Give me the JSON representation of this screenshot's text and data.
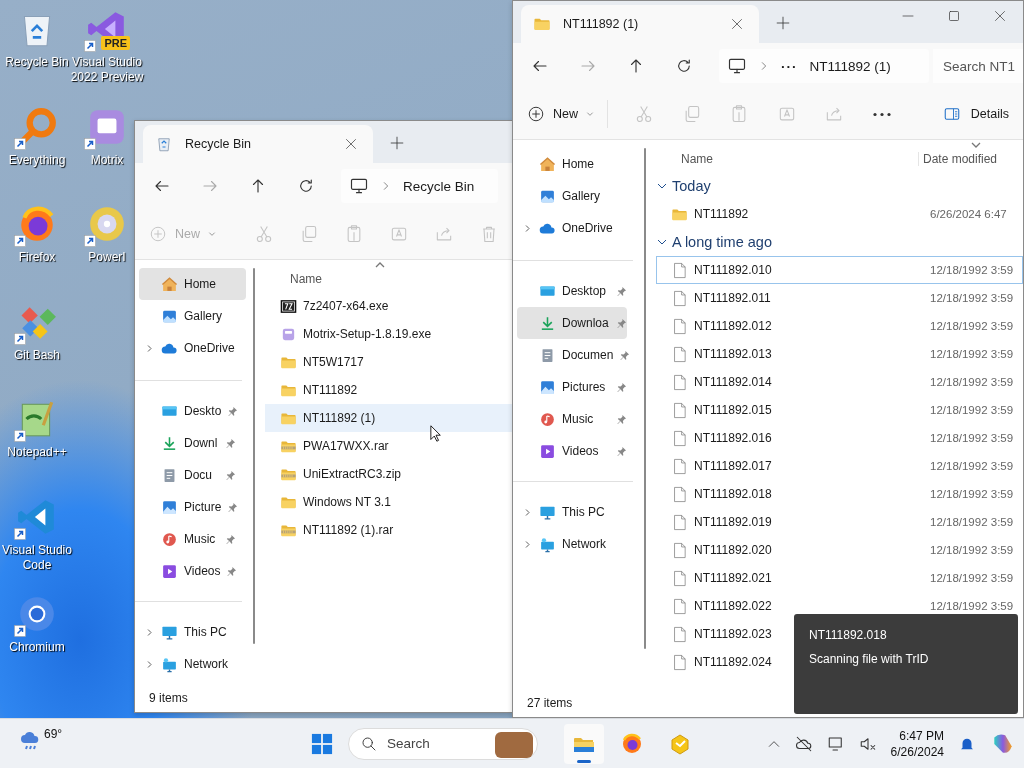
{
  "desktop_icons": [
    {
      "label": "Recycle Bin",
      "kind": "recycle",
      "shortcut": false
    },
    {
      "label": "Everything",
      "kind": "everything",
      "shortcut": true
    },
    {
      "label": "Firefox",
      "kind": "firefox",
      "shortcut": true
    },
    {
      "label": "Git Bash",
      "kind": "gitbash",
      "shortcut": true
    },
    {
      "label": "Notepad++",
      "kind": "notepad",
      "shortcut": true
    },
    {
      "label": "Visual Studio Code",
      "kind": "vscode",
      "shortcut": true
    },
    {
      "label": "Chromium",
      "kind": "chromium",
      "shortcut": true
    },
    {
      "label": "Visual Studio 2022 Preview",
      "kind": "vs",
      "shortcut": true,
      "badge": "PRE"
    },
    {
      "label": "Motrix",
      "kind": "motrix",
      "shortcut": true
    },
    {
      "label": "PowerI",
      "kind": "poweriso",
      "shortcut": true
    }
  ],
  "windows": [
    {
      "tab": {
        "title": "Recycle Bin"
      },
      "breadcrumb": [
        {
          "label": "Recycle Bin",
          "kind": "folder"
        }
      ],
      "toolbar": {
        "new": {
          "label": "New",
          "disabled": true
        },
        "actions": [
          {
            "kind": "cut",
            "disabled": true
          },
          {
            "kind": "copy",
            "disabled": true
          },
          {
            "kind": "paste",
            "disabled": true
          },
          {
            "kind": "rename",
            "disabled": true
          },
          {
            "kind": "share",
            "disabled": true
          },
          {
            "kind": "delete",
            "disabled": true
          }
        ]
      },
      "nav": [
        [
          {
            "label": "Home",
            "kind": "home",
            "selected": true,
            "pinned": false,
            "expandable": false
          },
          {
            "label": "Gallery",
            "kind": "gallery",
            "selected": false,
            "pinned": false,
            "expandable": false
          },
          {
            "label": "OneDrive",
            "kind": "onedrive",
            "selected": false,
            "pinned": false,
            "expandable": true
          }
        ],
        [
          {
            "label": "Deskto",
            "kind": "desktop",
            "selected": false,
            "pinned": true,
            "expandable": false
          },
          {
            "label": "Downl",
            "kind": "downloads",
            "selected": false,
            "pinned": true,
            "expandable": false
          },
          {
            "label": "Docu",
            "kind": "documents",
            "selected": false,
            "pinned": true,
            "expandable": false
          },
          {
            "label": "Picture",
            "kind": "pictures",
            "selected": false,
            "pinned": true,
            "expandable": false
          },
          {
            "label": "Music",
            "kind": "music",
            "selected": false,
            "pinned": true,
            "expandable": false
          },
          {
            "label": "Videos",
            "kind": "videos",
            "selected": false,
            "pinned": true,
            "expandable": false
          }
        ],
        [
          {
            "label": "This PC",
            "kind": "thispc",
            "selected": false,
            "pinned": false,
            "expandable": true
          },
          {
            "label": "Network",
            "kind": "network",
            "selected": false,
            "pinned": false,
            "expandable": true
          }
        ]
      ],
      "columns": [
        {
          "label": "Name",
          "sorted": true,
          "ascending": true
        }
      ],
      "groups": [
        {
          "files": [
            {
              "name": "7z2407-x64.exe",
              "kind": "sevenzip",
              "hovered": false
            },
            {
              "name": "Motrix-Setup-1.8.19.exe",
              "kind": "installer",
              "hovered": false
            },
            {
              "name": "NT5W1717",
              "kind": "folder",
              "hovered": false
            },
            {
              "name": "NT111892",
              "kind": "folder",
              "hovered": false
            },
            {
              "name": "NT111892 (1)",
              "kind": "folder",
              "hovered": true
            },
            {
              "name": "PWA17WXX.rar",
              "kind": "archive",
              "hovered": false
            },
            {
              "name": "UniExtractRC3.zip",
              "kind": "archive",
              "hovered": false
            },
            {
              "name": "Windows NT 3.1",
              "kind": "folder",
              "hovered": false
            },
            {
              "name": "NT111892 (1).rar",
              "kind": "archive",
              "hovered": false
            }
          ]
        }
      ],
      "status": "9 items"
    },
    {
      "tab": {
        "title": "NT111892 (1)"
      },
      "window_controls": true,
      "breadcrumb": [
        {
          "label": "···",
          "kind": "overflow"
        },
        {
          "label": "NT111892 (1)",
          "kind": "folder"
        }
      ],
      "search": {
        "placeholder": "Search NT1"
      },
      "toolbar": {
        "new": {
          "label": "New",
          "disabled": false
        },
        "actions": [
          {
            "kind": "cut",
            "disabled": true
          },
          {
            "kind": "copy",
            "disabled": true
          },
          {
            "kind": "paste",
            "disabled": true
          },
          {
            "kind": "rename",
            "disabled": true
          },
          {
            "kind": "share",
            "disabled": true
          },
          {
            "kind": "more",
            "disabled": false
          }
        ],
        "details": {
          "label": "Details"
        }
      },
      "nav": [
        [
          {
            "label": "Home",
            "kind": "home",
            "selected": false,
            "pinned": false,
            "expandable": false
          },
          {
            "label": "Gallery",
            "kind": "gallery",
            "selected": false,
            "pinned": false,
            "expandable": false
          },
          {
            "label": "OneDrive",
            "kind": "onedrive",
            "selected": false,
            "pinned": false,
            "expandable": true
          }
        ],
        [
          {
            "label": "Desktop",
            "kind": "desktop",
            "selected": false,
            "pinned": true,
            "expandable": false
          },
          {
            "label": "Downloa",
            "kind": "downloads",
            "selected": true,
            "pinned": true,
            "expandable": false
          },
          {
            "label": "Documen",
            "kind": "documents",
            "selected": false,
            "pinned": true,
            "expandable": false
          },
          {
            "label": "Pictures",
            "kind": "pictures",
            "selected": false,
            "pinned": true,
            "expandable": false
          },
          {
            "label": "Music",
            "kind": "music",
            "selected": false,
            "pinned": true,
            "expandable": false
          },
          {
            "label": "Videos",
            "kind": "videos",
            "selected": false,
            "pinned": true,
            "expandable": false
          }
        ],
        [
          {
            "label": "This PC",
            "kind": "thispc",
            "selected": false,
            "pinned": false,
            "expandable": true
          },
          {
            "label": "Network",
            "kind": "network",
            "selected": false,
            "pinned": false,
            "expandable": true
          }
        ]
      ],
      "columns": [
        {
          "label": "Name",
          "sorted": false
        },
        {
          "label": "Date modified",
          "sorted": true,
          "ascending": false
        }
      ],
      "groups": [
        {
          "title": "Today",
          "expanded": true,
          "files": [
            {
              "name": "NT111892",
              "kind": "folder",
              "date": "6/26/2024 6:47",
              "focused": false
            }
          ]
        },
        {
          "title": "A long time ago",
          "expanded": true,
          "files": [
            {
              "name": "NT111892.010",
              "kind": "file",
              "date": "12/18/1992 3:59",
              "focused": true
            },
            {
              "name": "NT111892.011",
              "kind": "file",
              "date": "12/18/1992 3:59",
              "focused": false
            },
            {
              "name": "NT111892.012",
              "kind": "file",
              "date": "12/18/1992 3:59",
              "focused": false
            },
            {
              "name": "NT111892.013",
              "kind": "file",
              "date": "12/18/1992 3:59",
              "focused": false
            },
            {
              "name": "NT111892.014",
              "kind": "file",
              "date": "12/18/1992 3:59",
              "focused": false
            },
            {
              "name": "NT111892.015",
              "kind": "file",
              "date": "12/18/1992 3:59",
              "focused": false
            },
            {
              "name": "NT111892.016",
              "kind": "file",
              "date": "12/18/1992 3:59",
              "focused": false
            },
            {
              "name": "NT111892.017",
              "kind": "file",
              "date": "12/18/1992 3:59",
              "focused": false
            },
            {
              "name": "NT111892.018",
              "kind": "file",
              "date": "12/18/1992 3:59",
              "focused": false
            },
            {
              "name": "NT111892.019",
              "kind": "file",
              "date": "12/18/1992 3:59",
              "focused": false
            },
            {
              "name": "NT111892.020",
              "kind": "file",
              "date": "12/18/1992 3:59",
              "focused": false
            },
            {
              "name": "NT111892.021",
              "kind": "file",
              "date": "12/18/1992 3:59",
              "focused": false
            },
            {
              "name": "NT111892.022",
              "kind": "file",
              "date": "12/18/1992 3:59",
              "focused": false
            },
            {
              "name": "NT111892.023",
              "kind": "file",
              "focused": false
            },
            {
              "name": "NT111892.024",
              "kind": "file",
              "focused": false
            }
          ]
        }
      ],
      "status": "27 items"
    }
  ],
  "toast": {
    "title": "NT111892.018",
    "message": "Scanning file with TrID"
  },
  "taskbar": {
    "weather": {
      "temperature": "69°"
    },
    "search": {
      "placeholder": "Search"
    },
    "apps": [
      {
        "kind": "explorer",
        "active": true
      },
      {
        "kind": "firefox",
        "active": false
      },
      {
        "kind": "yellowapp",
        "active": false
      }
    ],
    "clock": {
      "time": "6:47 PM",
      "date": "6/26/2024"
    }
  }
}
